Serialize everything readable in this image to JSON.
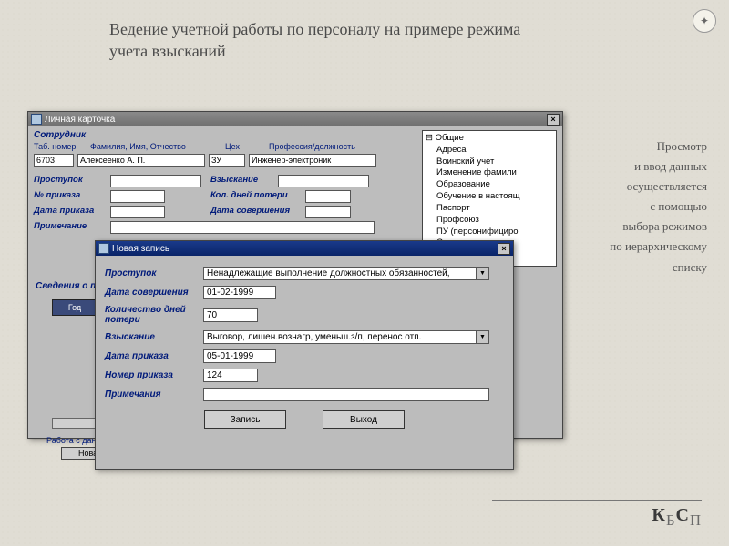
{
  "slide": {
    "title": "Ведение учетной работы по персоналу на примере режима учета взысканий",
    "side_lines": [
      "Просмотр",
      "и ввод данных",
      "осуществляется",
      "с помощью",
      "выбора режимов",
      "по иерархическому",
      "списку"
    ],
    "footer_k": "К",
    "footer_b": "Б",
    "footer_s": "С",
    "footer_p": "П"
  },
  "win1": {
    "title": "Личная карточка",
    "employee_lbl": "Сотрудник",
    "col_tab": "Таб. номер",
    "col_fio": "Фамилия, Имя, Отчество",
    "col_tseh": "Цех",
    "col_prof": "Профессия/должность",
    "tabno": "6703",
    "fio": "Алексеенко А. П.",
    "tseh": "ЗУ",
    "prof": "Инженер-электроник",
    "lbls": {
      "prostupok": "Проступок",
      "vzyskanie": "Взыскание",
      "noprikaza": "№ приказа",
      "koldney": "Кол. дней потери",
      "dataprikaza": "Дата приказа",
      "datasov": "Дата совершения",
      "prim": "Примечание"
    },
    "tree": {
      "root": "Общие",
      "items": [
        "Адреса",
        "Воинский учет",
        "Изменение фамили",
        "Образование",
        "Обучение в настоящ",
        "Паспорт",
        "Профсоюз",
        "ПУ (персонифициро",
        "Семья"
      ]
    },
    "section": "Сведения о прос",
    "tab_year": "Год",
    "bottom_lbl": "Работа с данны",
    "btn_new": "Новая"
  },
  "win2": {
    "title": "Новая запись",
    "prostupok_lbl": "Проступок",
    "prostupok_val": "Ненадлежащие выполнение должностных обязанностей,",
    "datasov_lbl": "Дата совершения",
    "datasov_val": "01-02-1999",
    "kol_lbl": "Количество дней потери",
    "kol_val": "70",
    "vzysk_lbl": "Взыскание",
    "vzysk_val": "Выговор, лишен.вознагр, уменьш.з/п, перенос отп.",
    "dataprik_lbl": "Дата приказа",
    "dataprik_val": "05-01-1999",
    "noprik_lbl": "Номер приказа",
    "noprik_val": "124",
    "prim_lbl": "Примечания",
    "btn_save": "Запись",
    "btn_exit": "Выход"
  }
}
